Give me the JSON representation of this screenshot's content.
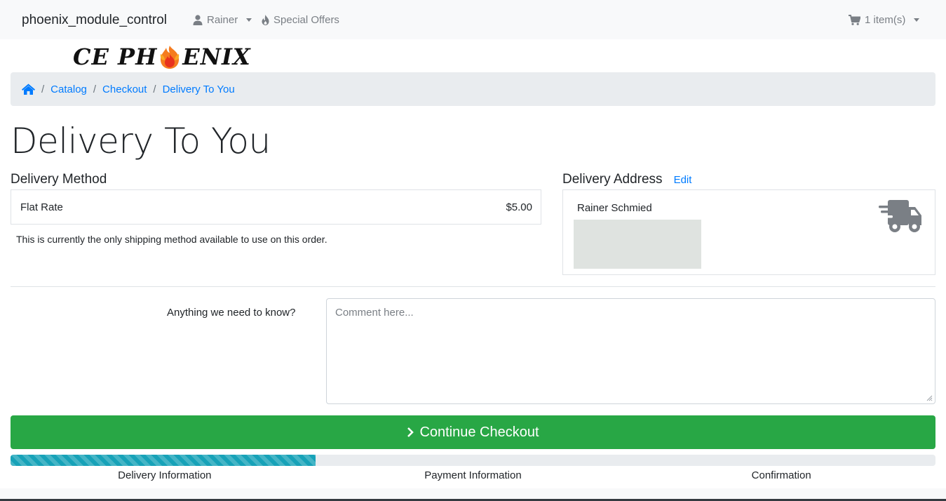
{
  "navbar": {
    "brand": "phoenix_module_control",
    "user": "Rainer",
    "offers": "Special Offers",
    "cart": "1 item(s)"
  },
  "logo": {
    "text_left": "CE PH",
    "text_right": "ENIX"
  },
  "breadcrumb": {
    "items": [
      "Catalog",
      "Checkout",
      "Delivery To You"
    ]
  },
  "page": {
    "title": "Delivery To You"
  },
  "delivery_method": {
    "title": "Delivery Method",
    "name": "Flat Rate",
    "price": "$5.00",
    "note": "This is currently the only shipping method available to use on this order."
  },
  "delivery_address": {
    "title": "Delivery Address",
    "edit_label": "Edit",
    "name": "Rainer Schmied"
  },
  "comment": {
    "label": "Anything we need to know?",
    "placeholder": "Comment here..."
  },
  "checkout": {
    "continue_label": "Continue Checkout"
  },
  "progress": {
    "percent": 33,
    "steps": [
      "Delivery Information",
      "Payment Information",
      "Confirmation"
    ]
  },
  "colors": {
    "primary": "#007bff",
    "success": "#28a745",
    "info": "#17a2b8"
  },
  "icons": {
    "user": "user-icon",
    "offers": "fire-icon",
    "cart": "cart-icon",
    "home": "home-icon",
    "truck": "shipping-fast-icon",
    "continue": "chevron-right-icon"
  }
}
